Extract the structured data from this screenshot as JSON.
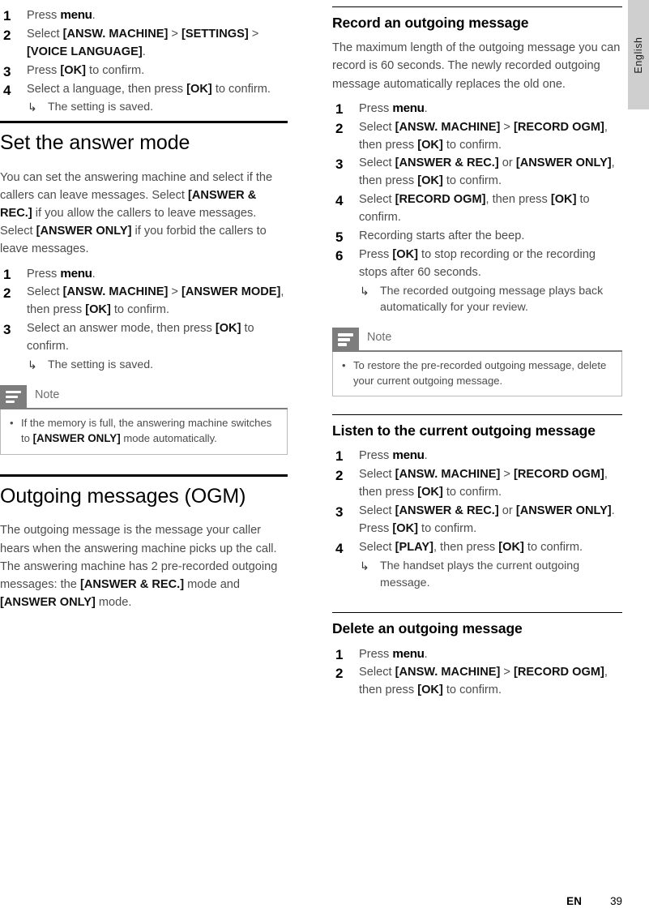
{
  "page": {
    "language_tab": "English",
    "footer_lang": "EN",
    "footer_page": "39"
  },
  "left_column": {
    "continued_steps": [
      {
        "num": "1",
        "text_html": "Press <b class=\"menuword\">menu</b>."
      },
      {
        "num": "2",
        "text_html": "Select <b>[ANSW. MACHINE]</b> &gt; <b>[SETTINGS]</b> &gt; <b>[VOICE LANGUAGE]</b>."
      },
      {
        "num": "3",
        "text_html": "Press <b>[OK]</b> to confirm."
      },
      {
        "num": "4",
        "text_html": "Select a language, then press <b>[OK]</b> to confirm.",
        "sub": "The setting is saved."
      }
    ],
    "section_answer_mode": {
      "heading": "Set the answer mode",
      "intro_html": "You can set the answering machine and select if the callers can leave messages. Select <b>[ANSWER &amp; REC.]</b> if you allow the callers to leave messages. Select <b>[ANSWER ONLY]</b> if you forbid the callers to leave messages.",
      "steps": [
        {
          "num": "1",
          "text_html": "Press <b class=\"menuword\">menu</b>."
        },
        {
          "num": "2",
          "text_html": "Select <b>[ANSW. MACHINE]</b> &gt; <b>[ANSWER MODE]</b>, then press <b>[OK]</b> to confirm."
        },
        {
          "num": "3",
          "text_html": "Select an answer mode, then press <b>[OK]</b> to confirm.",
          "sub": "The setting is saved."
        }
      ],
      "note": {
        "title": "Note",
        "items_html": [
          "If the memory is full, the answering machine switches to <b>[ANSWER ONLY]</b> mode automatically."
        ]
      }
    },
    "section_ogm": {
      "heading": "Outgoing messages (OGM)",
      "intro_html": "The outgoing message is the message your caller hears when the answering machine picks up the call. The answering machine has 2 pre-recorded outgoing messages: the <b>[ANSWER &amp; REC.]</b> mode and <b>[ANSWER ONLY]</b> mode."
    }
  },
  "right_column": {
    "section_record": {
      "heading": "Record an outgoing message",
      "intro_html": "The maximum length of the outgoing message you can record is 60 seconds. The newly recorded outgoing message automatically replaces the old one.",
      "steps": [
        {
          "num": "1",
          "text_html": "Press <b class=\"menuword\">menu</b>."
        },
        {
          "num": "2",
          "text_html": "Select <b>[ANSW. MACHINE]</b> &gt; <b>[RECORD OGM]</b>, then press <b>[OK]</b> to confirm."
        },
        {
          "num": "3",
          "text_html": "Select <b>[ANSWER &amp; REC.]</b> or <b>[ANSWER ONLY]</b>, then press <b>[OK]</b> to confirm."
        },
        {
          "num": "4",
          "text_html": "Select <b>[RECORD OGM]</b>, then press <b>[OK]</b> to confirm."
        },
        {
          "num": "5",
          "text_html": "Recording starts after the beep."
        },
        {
          "num": "6",
          "text_html": "Press <b>[OK]</b> to stop recording or the recording stops after 60 seconds.",
          "sub": "The recorded outgoing message plays back automatically for your review."
        }
      ],
      "note": {
        "title": "Note",
        "items_html": [
          "To restore the pre-recorded outgoing message, delete your current outgoing message."
        ]
      }
    },
    "section_listen": {
      "heading": "Listen to the current outgoing message",
      "steps": [
        {
          "num": "1",
          "text_html": "Press <b class=\"menuword\">menu</b>."
        },
        {
          "num": "2",
          "text_html": "Select <b>[ANSW. MACHINE]</b> &gt; <b>[RECORD OGM]</b>, then press <b>[OK]</b> to confirm."
        },
        {
          "num": "3",
          "text_html": "Select <b>[ANSWER &amp; REC.]</b> or <b>[ANSWER ONLY]</b>. Press <b>[OK]</b> to confirm."
        },
        {
          "num": "4",
          "text_html": "Select <b>[PLAY]</b>, then press <b>[OK]</b> to confirm.",
          "sub": "The handset plays the current outgoing message."
        }
      ]
    },
    "section_delete": {
      "heading": "Delete an outgoing message",
      "steps": [
        {
          "num": "1",
          "text_html": "Press <b class=\"menuword\">menu</b>."
        },
        {
          "num": "2",
          "text_html": "Select <b>[ANSW. MACHINE]</b> &gt; <b>[RECORD OGM]</b>, then press <b>[OK]</b> to confirm."
        }
      ]
    }
  },
  "icons": {
    "note_icon": "note-lines-icon",
    "substep_arrow": "↳",
    "bullet": "•"
  }
}
